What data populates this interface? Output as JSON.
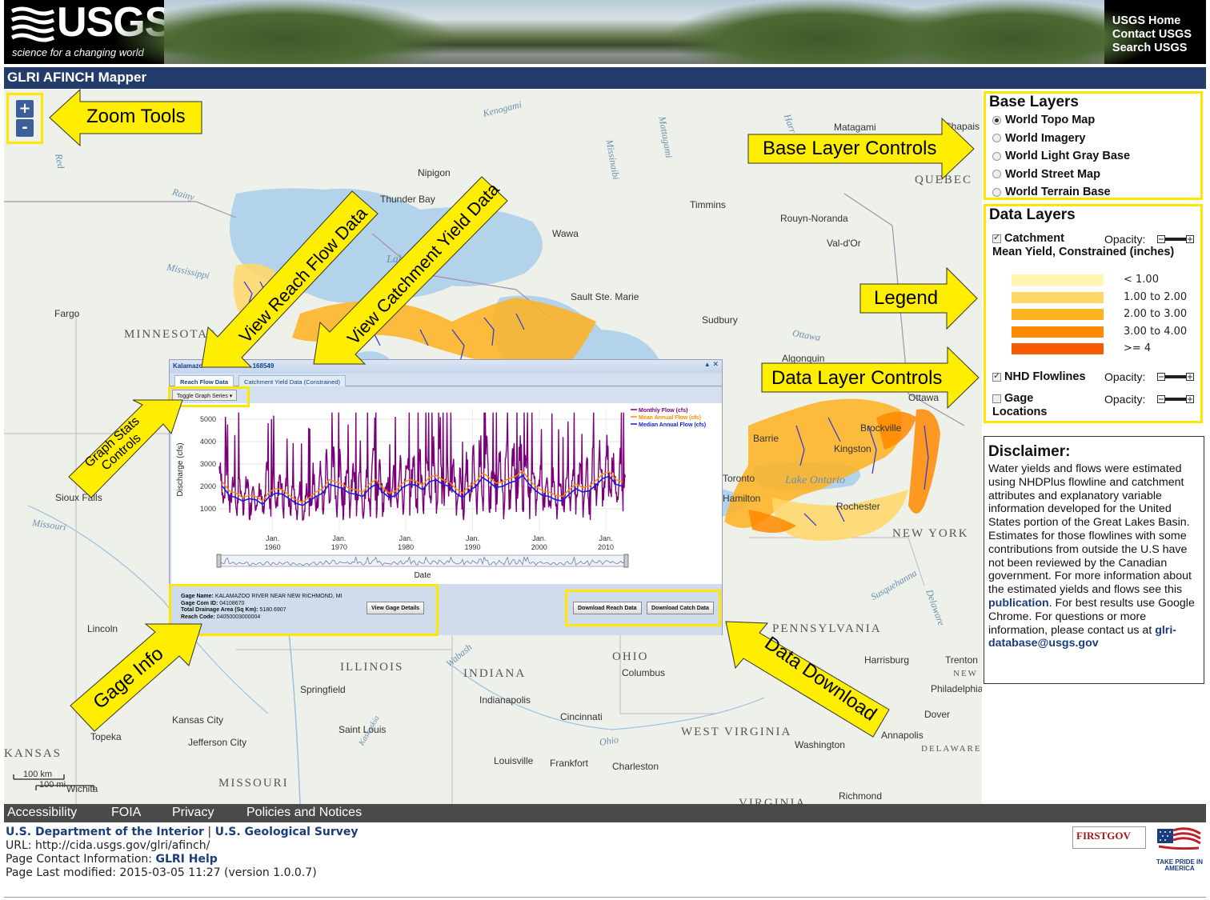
{
  "header": {
    "logo_text": "USGS",
    "logo_tagline": "science for a changing world",
    "links": [
      "USGS Home",
      "Contact USGS",
      "Search USGS"
    ]
  },
  "app_title": "GLRI AFINCH Mapper",
  "zoom": {
    "in": "+",
    "out": "-"
  },
  "map_labels": {
    "places": [
      "Nipigon",
      "Thunder Bay",
      "Wawa",
      "Timmins",
      "Matagami",
      "Chapais",
      "Rouyn-Noranda",
      "Val-d'Or",
      "Sault Ste. Marie",
      "Sudbury",
      "Algonquin",
      "Fargo",
      "Sioux Falls",
      "Lincoln",
      "Topeka",
      "Kansas City",
      "Jefferson City",
      "Saint Louis",
      "Springfield",
      "Indianapolis",
      "Columbus",
      "Cincinnati",
      "Louisville",
      "Frankfort",
      "Charleston",
      "Washington",
      "Richmond",
      "Dover",
      "Annapolis",
      "Harrisburg",
      "Trenton",
      "Philadelphia",
      "Kingston",
      "Brockville",
      "Barrie",
      "Toronto",
      "Hamilton",
      "Rochester",
      "Ottawa",
      "Wichita"
    ],
    "states": [
      "MINNESOTA",
      "QUEBEC",
      "ILLINOIS",
      "INDIANA",
      "OHIO",
      "PENNSYLVANIA",
      "NEW YORK",
      "WEST VIRGINIA",
      "MISSOURI",
      "KANSAS",
      "DELAWARE",
      "VIRGINIA",
      "NEW"
    ],
    "water": [
      "Kenogami",
      "Rainy",
      "Mississippi",
      "Missouri",
      "Lake Ontario",
      "Ottawa",
      "Ohio",
      "Wabash",
      "Kaskaskia",
      "Delaware",
      "Susquehanna",
      "Harr",
      "Mattagami",
      "Missinaibi",
      "Red",
      "Lake"
    ],
    "scale": [
      "100 km",
      "100 mi"
    ]
  },
  "callouts": {
    "zoom": "Zoom Tools",
    "base": "Base Layer Controls",
    "legend": "Legend",
    "data_layers": "Data Layer Controls",
    "reach": "View Reach Flow Data",
    "catchment": "View Catchment Yield Data",
    "graph_stats": "Graph Stats Controls",
    "gage_info": "Gage Info",
    "download": "Data Download"
  },
  "base_layers": {
    "title": "Base Layers",
    "options": [
      "World Topo Map",
      "World Imagery",
      "World Light Gray Base",
      "World Street Map",
      "World Terrain Base"
    ],
    "selected_index": 0
  },
  "data_layers": {
    "title": "Data Layers",
    "catchment_label": "Catchment",
    "opacity_label": "Opacity:",
    "legend_title": "Mean Yield, Constrained (inches)",
    "legend": [
      {
        "label": "< 1.00",
        "color": "#fff5b0"
      },
      {
        "label": "1.00 to 2.00",
        "color": "#ffd766"
      },
      {
        "label": "2.00 to 3.00",
        "color": "#ffb21f"
      },
      {
        "label": "3.00 to 4.00",
        "color": "#ff8a00"
      },
      {
        "label": ">= 4",
        "color": "#f55a00"
      }
    ],
    "nhd_label": "NHD Flowlines",
    "gage_label": "Gage Locations"
  },
  "disclaimer": {
    "title": "Disclaimer:",
    "text_before": "Water yields and flows were estimated using NHDPlus flowline and catchment attributes and explanatory variable information developed for the United States portion of the Great Lakes Basin. Estimates for those flowlines with some contributions from outside the U.S have not been reviewed by the Canadian government. For more information about the estimated yields and flows see this ",
    "link": "publication",
    "text_mid": ". For best results use Google Chrome. For questions or more information, please contact us at ",
    "email": "glri-database@usgs.gov"
  },
  "graph_window": {
    "title_left": "Kalamazo",
    "title_right": "168549",
    "tabs": [
      "Reach Flow Data",
      "Catchment Yield Data (Constrained)"
    ],
    "toggle": "Toggle Graph Series ▾",
    "y_label": "Discharge (cfs)",
    "x_label": "Date",
    "legend": [
      "Monthly Flow (cfs)",
      "Mean Annual Flow (cfs)",
      "Median Annual Flow (cfs)"
    ],
    "gage_name_label": "Gage Name:",
    "gage_name": "KALAMAZOO RIVER NEAR NEW RICHMOND, MI",
    "gage_com_label": "Gage Com ID:",
    "gage_com": "04108670",
    "drainage_label": "Total Drainage Area (Sq Km):",
    "drainage": "5180.6907",
    "reach_label": "Reach Code:",
    "reach": "04050003000004",
    "view_gage": "View Gage Details",
    "download_reach": "Download Reach Data",
    "download_catch": "Download Catch Data"
  },
  "chart_data": {
    "type": "line",
    "y_ticks": [
      1000,
      2000,
      3000,
      4000,
      5000
    ],
    "x_ticks": [
      "Jan. 1960",
      "Jan. 1970",
      "Jan. 1980",
      "Jan. 1990",
      "Jan. 2000",
      "Jan. 2010"
    ],
    "x_range": [
      1952,
      2013
    ],
    "ylim": [
      0,
      5500
    ],
    "series": [
      {
        "name": "Monthly Flow (cfs)",
        "color": "#7a007a"
      },
      {
        "name": "Mean Annual Flow (cfs)",
        "color": "#ff8c00"
      },
      {
        "name": "Median Annual Flow (cfs)",
        "color": "#1a1adf"
      }
    ],
    "annual_mean": [
      2200,
      1800,
      1700,
      1500,
      1600,
      1550,
      1350,
      1750,
      1900,
      1850,
      1600,
      1400,
      1300,
      1500,
      1750,
      1900,
      2300,
      2200,
      2100,
      1900,
      1850,
      1750,
      2100,
      2300,
      1950,
      1700,
      1800,
      2150,
      2300,
      2250,
      2050,
      2400,
      2500,
      2300,
      2200,
      1900,
      1700,
      2000,
      2200,
      2600,
      2400,
      2150,
      2200,
      2350,
      2450,
      2700,
      2300,
      2000,
      1800,
      1750,
      1600,
      1550,
      1850,
      2100,
      1950,
      2000,
      2250,
      2550,
      2650,
      2300,
      2200
    ],
    "annual_median": [
      2000,
      1600,
      1500,
      1350,
      1450,
      1400,
      1200,
      1550,
      1700,
      1650,
      1450,
      1250,
      1150,
      1350,
      1550,
      1700,
      2100,
      2000,
      1900,
      1700,
      1650,
      1550,
      1900,
      2100,
      1750,
      1500,
      1600,
      1950,
      2100,
      2050,
      1850,
      2200,
      2300,
      2100,
      2000,
      1700,
      1500,
      1800,
      2000,
      2400,
      2200,
      1950,
      2000,
      2150,
      2250,
      2500,
      2100,
      1800,
      1600,
      1550,
      1400,
      1350,
      1650,
      1900,
      1750,
      1800,
      2050,
      2350,
      2450,
      2100,
      2000
    ]
  },
  "footer": {
    "links": [
      "Accessibility",
      "FOIA",
      "Privacy",
      "Policies and Notices"
    ],
    "dept": "U.S. Department of the Interior",
    "sep": "|",
    "survey": "U.S. Geological Survey",
    "url_line": "URL: http://cida.usgs.gov/glri/afinch/",
    "contact_label": "Page Contact Information:",
    "contact_link": "GLRI Help",
    "modified": "Page Last modified: 2015-03-05 11:27 (version 1.0.0.7)",
    "firstgov": "FIRSTGOV",
    "tpa": "TAKE PRIDE IN AMERICA"
  }
}
